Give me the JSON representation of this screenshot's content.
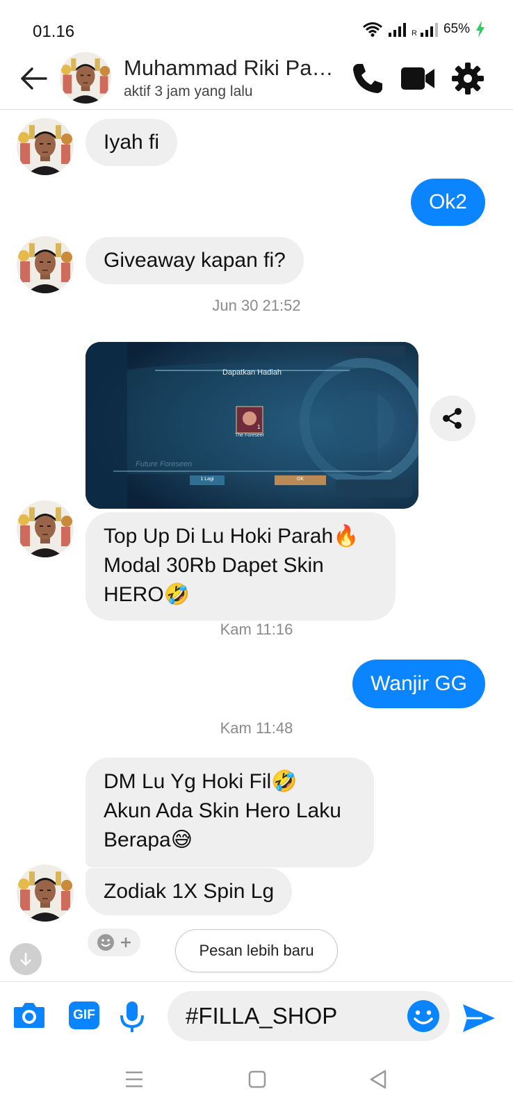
{
  "status": {
    "time": "01.16",
    "battery": "65%",
    "roaming": "R"
  },
  "header": {
    "name": "Muhammad Riki Pa…",
    "subtitle": "aktif 3 jam yang lalu"
  },
  "messages": {
    "m1": "Iyah fi",
    "m2": "Ok2",
    "m3": "Giveaway kapan fi?",
    "ts1": "Jun 30 21:52",
    "m4_l1": "Top Up Di Lu Hoki Parah",
    "m4_l2": "Modal 30Rb Dapet Skin",
    "m4_l3": "HERO",
    "ts2": "Kam 11:16",
    "m5": "Wanjir GG",
    "ts3": "Kam 11:48",
    "m6_l1": "DM Lu Yg Hoki Fil",
    "m6_l2": "Akun Ada Skin Hero Laku",
    "m6_l3": "Berapa",
    "m7": "Zodiak 1X Spin Lg"
  },
  "image_message": {
    "dialog_title": "Dapatkan Hadiah",
    "item_name": "The Foreseer",
    "item_count": "1",
    "btn_left": "1 Lagi",
    "btn_right": "OK",
    "bottom_text": "Future Foreseen"
  },
  "newer_messages_label": "Pesan lebih baru",
  "composer": {
    "gif_label": "GIF",
    "input_value": "#FILLA_SHOP"
  },
  "colors": {
    "accent": "#0a84ff",
    "incoming_bubble": "#efefef"
  },
  "icons": [
    "back-arrow-icon",
    "phone-icon",
    "video-camera-icon",
    "gear-icon",
    "share-icon",
    "smiley-icon",
    "plus-icon",
    "arrow-down-icon",
    "camera-icon",
    "gif-icon",
    "microphone-icon",
    "send-icon",
    "menu-icon",
    "home-icon",
    "back-triangle-icon"
  ]
}
